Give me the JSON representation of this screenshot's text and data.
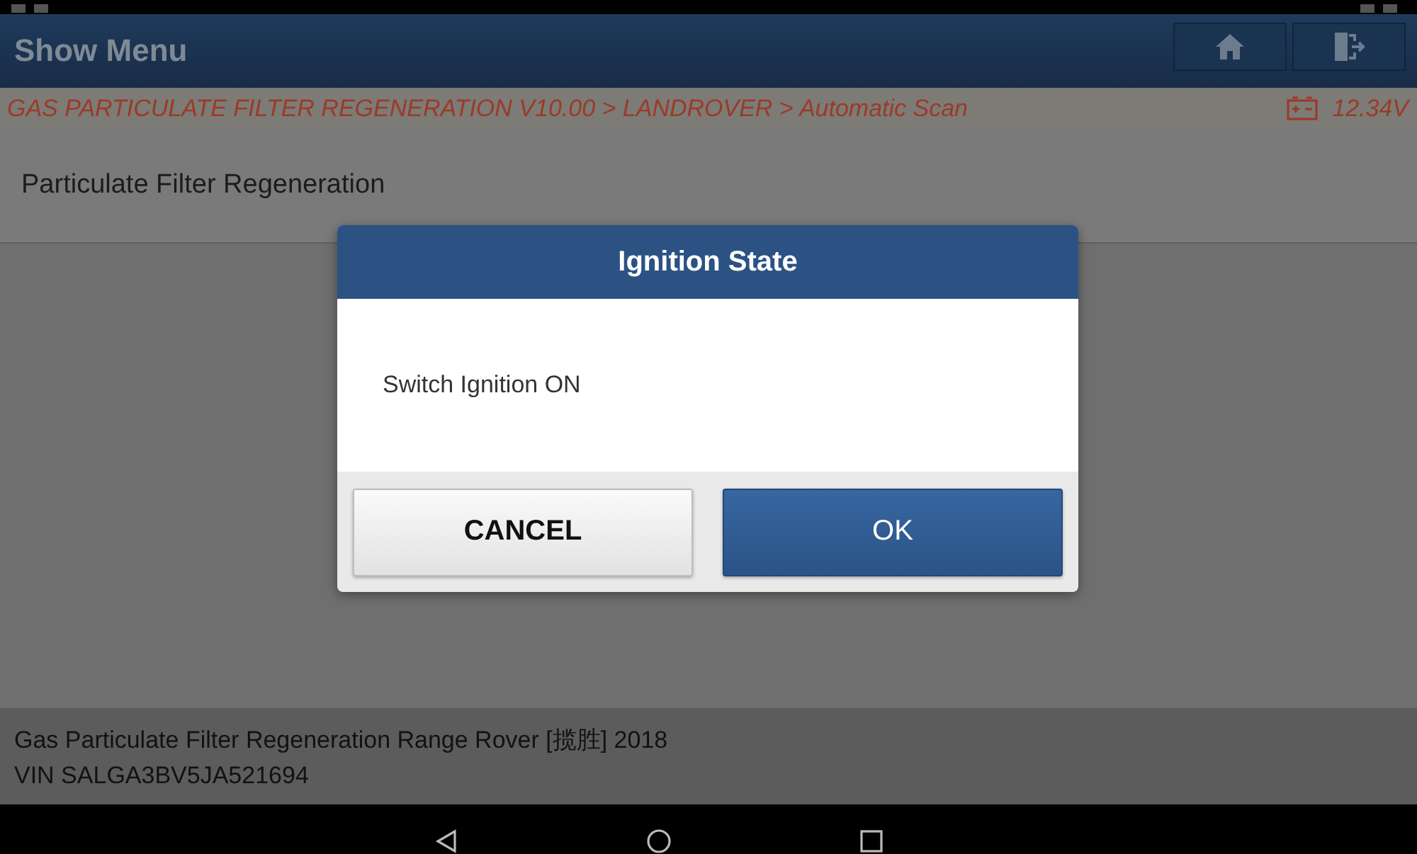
{
  "header": {
    "title": "Show Menu"
  },
  "breadcrumb": {
    "path": "GAS PARTICULATE FILTER REGENERATION V10.00 > LANDROVER > Automatic Scan",
    "voltage": "12.34V"
  },
  "menu": {
    "items": [
      {
        "label": "Particulate Filter Regeneration"
      }
    ]
  },
  "dialog": {
    "title": "Ignition State",
    "message": "Switch Ignition ON",
    "buttons": [
      {
        "label": "CANCEL",
        "kind": "secondary"
      },
      {
        "label": "OK",
        "kind": "primary"
      }
    ]
  },
  "footer": {
    "lines": [
      "Gas Particulate Filter Regeneration Range Rover [揽胜] 2018",
      "VIN SALGA3BV5JA521694"
    ]
  }
}
